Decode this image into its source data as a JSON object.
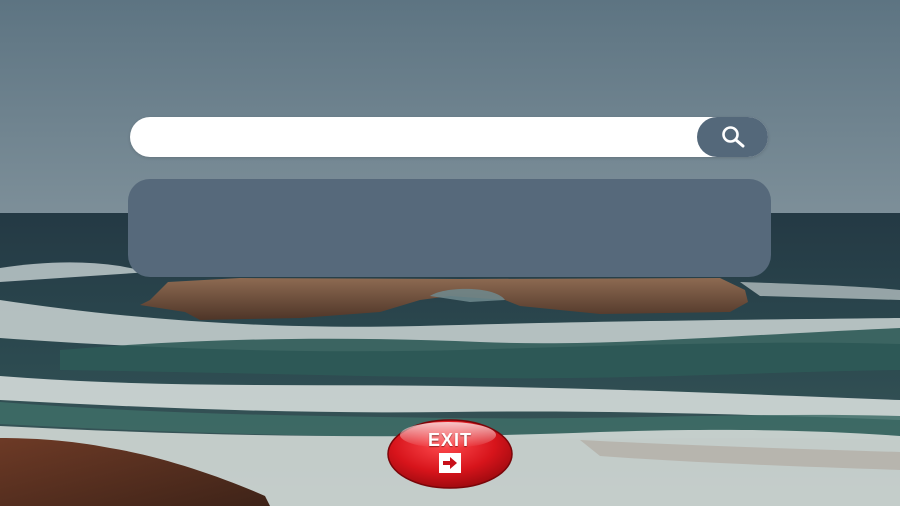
{
  "search": {
    "value": "",
    "placeholder": "",
    "button_icon": "search-icon"
  },
  "results": {
    "items": []
  },
  "exit": {
    "label": "EXIT",
    "icon": "exit-arrow-icon"
  },
  "colors": {
    "search_button": "#54687a",
    "results_panel": "#56697b",
    "exit_button": "#d8141b"
  }
}
